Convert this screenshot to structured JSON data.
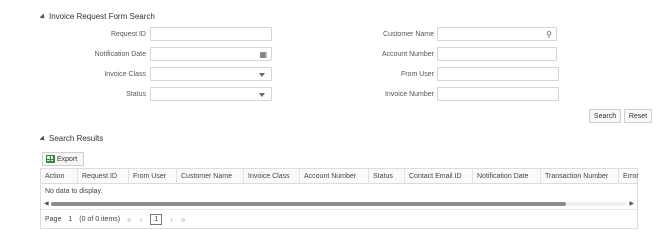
{
  "search_section": {
    "title": "Invoice Request Form Search",
    "fields": {
      "request_id": {
        "label": "Request ID",
        "value": ""
      },
      "customer_name": {
        "label": "Customer Name",
        "value": ""
      },
      "notification_date": {
        "label": "Notification Date",
        "value": ""
      },
      "account_number": {
        "label": "Account Number",
        "value": ""
      },
      "invoice_class": {
        "label": "Invoice Class",
        "value": ""
      },
      "from_user": {
        "label": "From User",
        "value": ""
      },
      "status": {
        "label": "Status",
        "value": ""
      },
      "invoice_number": {
        "label": "Invoice Number",
        "value": ""
      }
    },
    "buttons": {
      "search": "Search",
      "reset": "Reset"
    }
  },
  "results_section": {
    "title": "Search Results",
    "export_label": "Export",
    "columns": [
      "Action",
      "Request ID",
      "From User",
      "Customer Name",
      "Invoice Class",
      "Account Number",
      "Status",
      "Contact Email ID",
      "Notification Date",
      "Transaction Number",
      "Error"
    ],
    "empty_message": "No data to display.",
    "pagination": {
      "page_label": "Page",
      "page_number": "1",
      "items_summary": "(0 of 0 items)",
      "current_page": "1"
    }
  },
  "icons": {
    "search": "search-icon",
    "calendar": "calendar-icon",
    "dropdown": "chevron-down-icon",
    "export": "spreadsheet-icon"
  }
}
